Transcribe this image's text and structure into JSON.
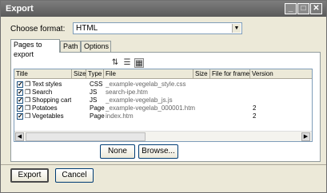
{
  "window": {
    "title": "Export"
  },
  "titlebar": {
    "minimize": "_",
    "maximize": "□",
    "close": "✕"
  },
  "format": {
    "label": "Choose format:",
    "value": "HTML"
  },
  "tabs": [
    {
      "label": "Pages to export"
    },
    {
      "label": "Path"
    },
    {
      "label": "Options"
    }
  ],
  "grid": {
    "columns": [
      "Title",
      "Size",
      "Type",
      "File",
      "Size",
      "File for frame",
      "Version"
    ],
    "rows": [
      {
        "title": "Text styles",
        "size": "",
        "type": "CSS",
        "file": "_example-vegelab_style.css",
        "size2": "",
        "frame": "",
        "version": ""
      },
      {
        "title": "Search",
        "size": "",
        "type": "JS",
        "file": "search-ipe.htm",
        "size2": "",
        "frame": "",
        "version": ""
      },
      {
        "title": "Shopping cart",
        "size": "",
        "type": "JS",
        "file": "_example-vegelab_js.js",
        "size2": "",
        "frame": "",
        "version": ""
      },
      {
        "title": "Potatoes",
        "size": "",
        "type": "Page",
        "file": "_example-vegelab_000001.htm",
        "size2": "",
        "frame": "",
        "version": "2"
      },
      {
        "title": "Vegetables",
        "size": "",
        "type": "Page",
        "file": "index.htm",
        "size2": "",
        "frame": "",
        "version": "2"
      }
    ]
  },
  "buttons": {
    "none": "None",
    "browse": "Browse...",
    "export": "Export",
    "cancel": "Cancel"
  }
}
